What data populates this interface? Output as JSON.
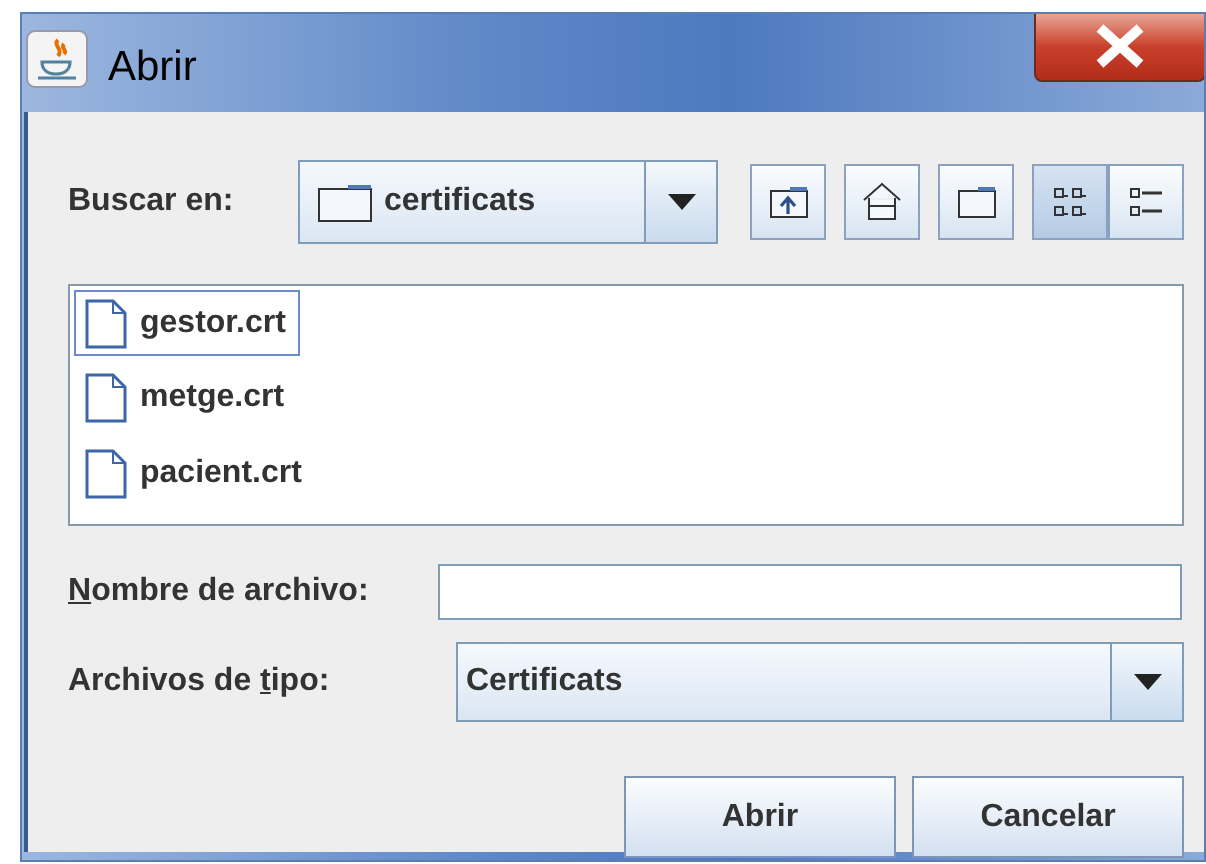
{
  "window": {
    "title": "Abrir"
  },
  "look_in": {
    "label": "Buscar en:",
    "value": "certificats"
  },
  "toolbar": [
    {
      "kind": "up",
      "selected": false
    },
    {
      "kind": "home",
      "selected": false
    },
    {
      "kind": "newfolder",
      "selected": false
    },
    {
      "kind": "list",
      "selected": true
    },
    {
      "kind": "details",
      "selected": false
    }
  ],
  "files": [
    {
      "name": "gestor.crt",
      "selected": true
    },
    {
      "name": "metge.crt",
      "selected": false
    },
    {
      "name": "pacient.crt",
      "selected": false
    }
  ],
  "file_name": {
    "label": {
      "key": "N",
      "after": "ombre de archivo:"
    }
  },
  "file_type": {
    "label": {
      "before": "Archivos de ",
      "key": "t",
      "after": "ipo:"
    },
    "value": "Certificats"
  },
  "buttons": [
    "Abrir",
    "Cancelar"
  ]
}
